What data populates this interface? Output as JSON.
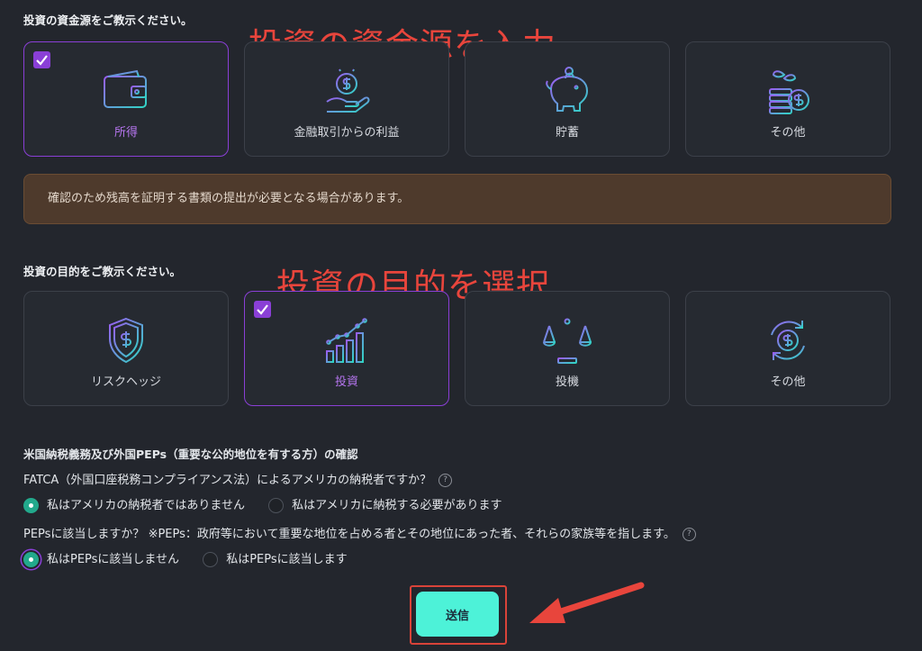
{
  "funding": {
    "title": "投資の資金源をご教示ください。",
    "annotation": "投資の資金源を入力",
    "options": [
      {
        "label": "所得",
        "icon": "wallet-icon",
        "selected": true
      },
      {
        "label": "金融取引からの利益",
        "icon": "coin-hand-icon",
        "selected": false
      },
      {
        "label": "貯蓄",
        "icon": "piggy-bank-icon",
        "selected": false
      },
      {
        "label": "その他",
        "icon": "plant-coins-icon",
        "selected": false
      }
    ],
    "notice": "確認のため残高を証明する書類の提出が必要となる場合があります。"
  },
  "purpose": {
    "title": "投資の目的をご教示ください。",
    "annotation": "投資の目的を選択",
    "options": [
      {
        "label": "リスクヘッジ",
        "icon": "shield-dollar-icon",
        "selected": false
      },
      {
        "label": "投資",
        "icon": "bar-chart-growth-icon",
        "selected": true
      },
      {
        "label": "投機",
        "icon": "scales-icon",
        "selected": false
      },
      {
        "label": "その他",
        "icon": "circular-dollar-icon",
        "selected": false
      }
    ]
  },
  "tax": {
    "heading": "米国納税義務及び外国PEPs（重要な公的地位を有する方）の確認",
    "fatca_question": "FATCA（外国口座税務コンプライアンス法）によるアメリカの納税者ですか？",
    "fatca_options": [
      "私はアメリカの納税者ではありません",
      "私はアメリカに納税する必要があります"
    ],
    "fatca_selected": 0,
    "peps_question": "PEPsに該当しますか？ ※PEPs：政府等において重要な地位を占める者とその地位にあった者、それらの家族等を指します。",
    "peps_options": [
      "私はPEPsに該当しません",
      "私はPEPsに該当します"
    ],
    "peps_selected": 0,
    "help_glyph": "?"
  },
  "submit_label": "送信",
  "colors": {
    "background": "#23262d",
    "card_border": "#3c4049",
    "selected_accent": "#8a3fd6",
    "teal_icon": "#2fd6c4",
    "purple_icon": "#9a5cf0",
    "notice_bg": "#4e3a2c",
    "radio_on": "#22a98c",
    "submit_bg": "#4df2d8",
    "annotation_red": "#e8453c"
  }
}
